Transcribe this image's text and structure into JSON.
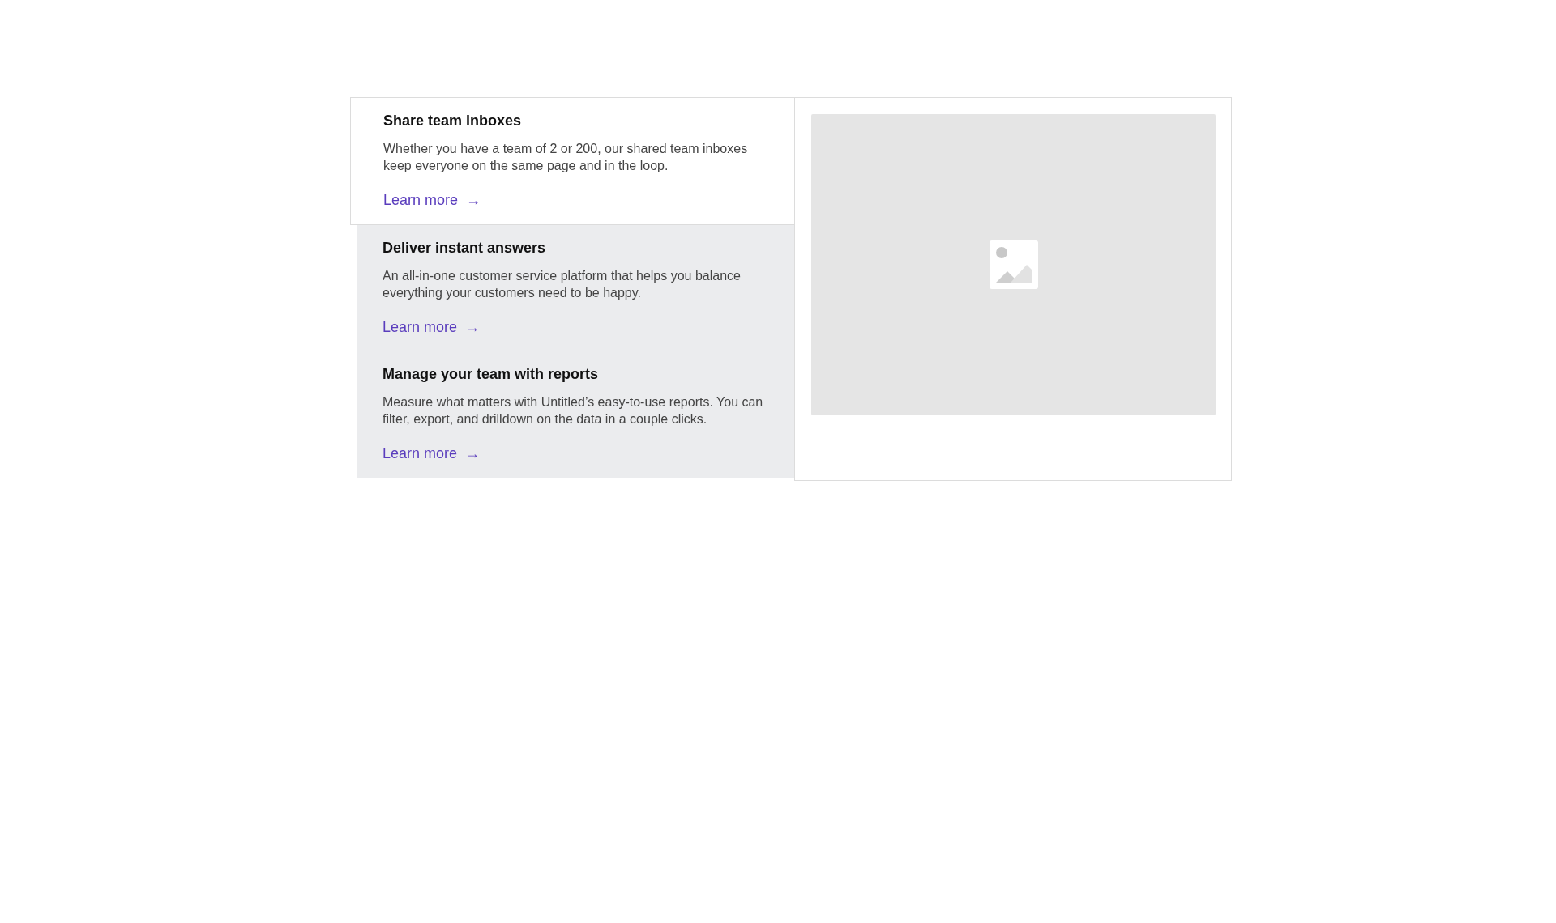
{
  "features": [
    {
      "title": "Share team inboxes",
      "description": "Whether you have a team of 2 or 200, our shared team inboxes keep everyone on the same page and in the loop.",
      "link": "Learn more",
      "arrow": "→",
      "selected": true
    },
    {
      "title": "Deliver instant answers",
      "description": "An all-in-one customer service platform that helps you balance everything your customers need to be happy.",
      "link": "Learn more",
      "arrow": "→",
      "selected": false
    },
    {
      "title": "Manage your team with reports",
      "description": "Measure what matters with Untitled’s easy-to-use reports. You can filter, export, and drilldown on the data in a couple clicks.",
      "link": "Learn more",
      "arrow": "→",
      "selected": false
    }
  ]
}
